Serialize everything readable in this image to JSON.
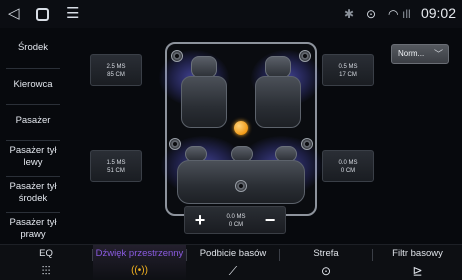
{
  "status_bar": {
    "back_icon": "back-triangle-icon",
    "home_icon": "home-square-icon",
    "menu_icon": "hamburger-menu-icon",
    "bluetooth_icon": "bluetooth-icon",
    "location_icon": "location-pin-icon",
    "wifi_icon": "wifi-icon",
    "signal_icon": "signal-icon",
    "time": "09:02"
  },
  "sidebar": {
    "items": [
      {
        "label": "Środek"
      },
      {
        "label": "Kierowca"
      },
      {
        "label": "Pasażer"
      },
      {
        "label": "Pasażer tył lewy"
      },
      {
        "label": "Pasażer tył środek"
      },
      {
        "label": "Pasażer tył prawy"
      }
    ]
  },
  "speakers": {
    "front_left": {
      "delay": "2.5 MS",
      "distance": "85 CM"
    },
    "front_right": {
      "delay": "0.5 MS",
      "distance": "17 CM"
    },
    "rear_left": {
      "delay": "1.5 MS",
      "distance": "51 CM"
    },
    "rear_right": {
      "delay": "0.0 MS",
      "distance": "0 CM"
    }
  },
  "mode_dropdown": {
    "selected": "Norm..."
  },
  "adjuster": {
    "value_delay": "0.0 MS",
    "value_distance": "0 CM",
    "plus": "+",
    "minus": "−"
  },
  "bottom_tabs": [
    {
      "label": "EQ",
      "icon": "equalizer-sliders-icon",
      "active": false
    },
    {
      "label": "Dźwięk przestrzenny",
      "icon": "surround-waves-icon",
      "active": true
    },
    {
      "label": "Podbicie basów",
      "icon": "bass-boost-graph-icon",
      "active": false
    },
    {
      "label": "Strefa",
      "icon": "zone-target-icon",
      "active": false
    },
    {
      "label": "Filtr basowy",
      "icon": "bass-filter-icon",
      "active": false
    }
  ],
  "colors": {
    "accent_purple": "#8a5be0",
    "accent_orange": "#f3b21f",
    "glow_blue": "#6e6eff"
  }
}
